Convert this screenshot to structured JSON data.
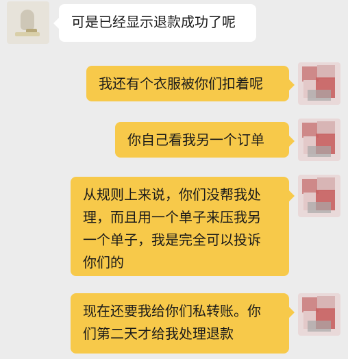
{
  "messages": [
    {
      "sender": "other",
      "text": "可是已经显示退款成功了呢"
    },
    {
      "sender": "me",
      "text": "我还有个衣服被你们扣着呢"
    },
    {
      "sender": "me",
      "text": "你自己看我另一个订单"
    },
    {
      "sender": "me",
      "text": "从规则上来说，你们没帮我处\n理，而且用一个单子来压我另\n一个单子，我是完全可以投诉\n你们的"
    },
    {
      "sender": "me",
      "text": "现在还要我给你们私转账。你\n们第二天才给我处理退款"
    }
  ],
  "colors": {
    "background": "#ececec",
    "incoming_bubble": "#ffffff",
    "outgoing_bubble": "#f7c94a"
  },
  "icons": {
    "other_avatar": "blurred-avatar-icon",
    "my_avatar": "blurred-avatar-icon"
  }
}
